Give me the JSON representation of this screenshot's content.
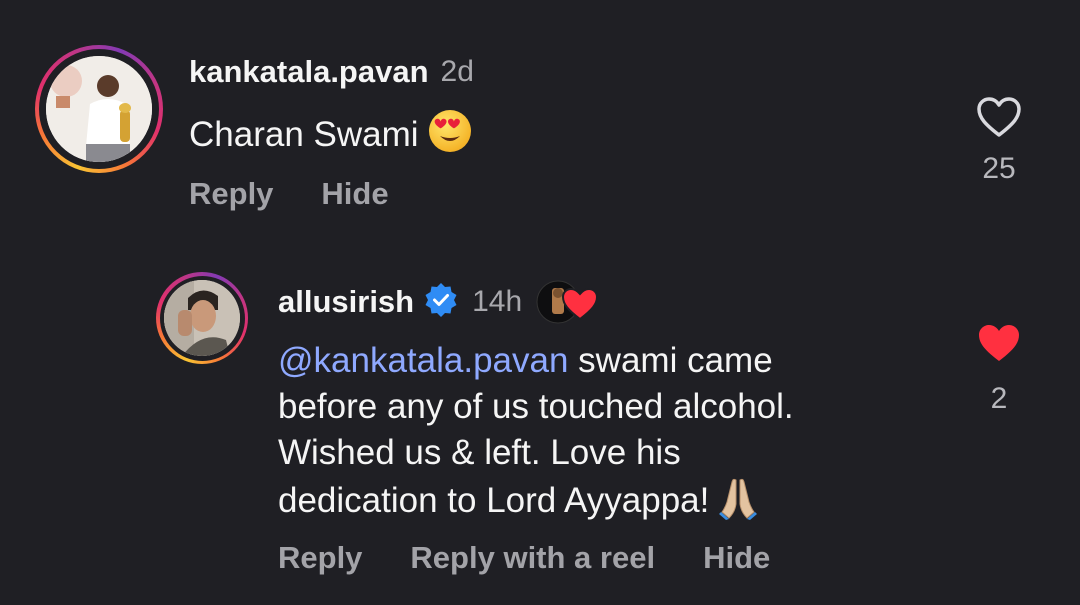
{
  "comments": [
    {
      "username": "kankatala.pavan",
      "time": "2d",
      "text": "Charan Swami",
      "emoji": "heart-eyes-emoji",
      "actions": [
        "Reply",
        "Hide"
      ],
      "likes": "25",
      "liked": false
    },
    {
      "username": "allusirish",
      "verified": true,
      "time": "14h",
      "mention": "@kankatala.pavan",
      "text_line1": " swami came",
      "text_line2": "before any of us touched alcohol.",
      "text_line3": "Wished us & left. Love his",
      "text_line4": "dedication to Lord Ayyappa!",
      "emoji": "folded-hands-emoji",
      "actions": [
        "Reply",
        "Reply with a reel",
        "Hide"
      ],
      "likes": "2",
      "liked": true
    }
  ],
  "colors": {
    "background": "#1f1f24",
    "mention": "#8fa9ff",
    "liked_heart": "#ff3040",
    "verified": "#2f8cf5"
  }
}
